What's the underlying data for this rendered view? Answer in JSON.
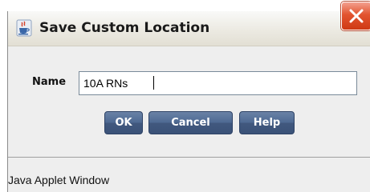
{
  "window": {
    "title": "Save Custom Location",
    "icon": "java-cup-icon",
    "close_icon": "close-icon",
    "close_color": "#e04a24"
  },
  "form": {
    "name_label": "Name",
    "name_value": "10A RNs"
  },
  "buttons": {
    "ok_label": "OK",
    "cancel_label": "Cancel",
    "help_label": "Help",
    "color": "#4e6a93"
  },
  "status": {
    "text": "Java Applet Window"
  }
}
